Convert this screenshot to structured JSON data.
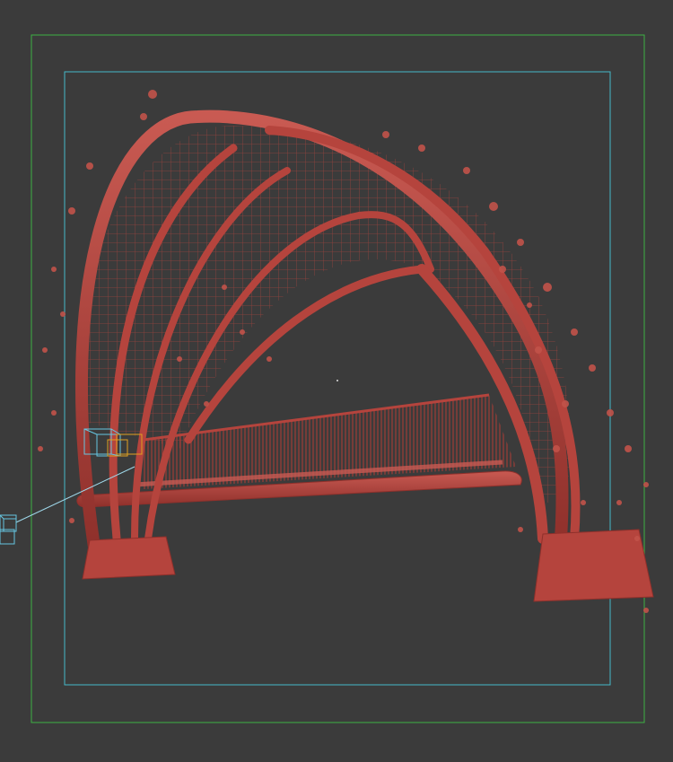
{
  "viewport": {
    "background": "#3b3b3b",
    "safe_frame_color": "#3cb043",
    "render_frame_color": "#45b9c9",
    "model_color": "#b5443d",
    "leaf_color": "#c2534a",
    "selection_color": "#e0a020",
    "camera_color": "#66c6e0"
  },
  "scene": {
    "object_icon": "camera-icon",
    "target_icon": "camera-target-icon",
    "model_icon": "swing-bench-arch-model"
  }
}
